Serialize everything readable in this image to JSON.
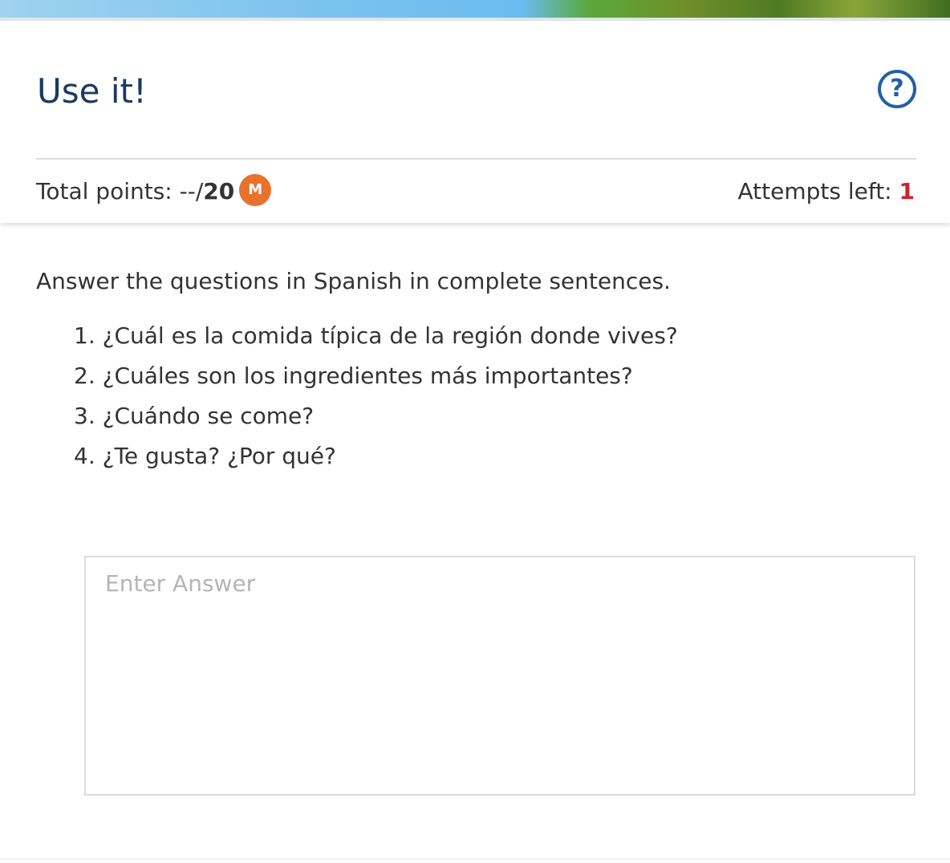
{
  "header": {
    "title": "Use it!",
    "help_icon": "question-circle-icon",
    "help_glyph": "?"
  },
  "scorebar": {
    "total_points_label": "Total points: --/",
    "total_points_max": "20",
    "badge_letter": "M",
    "badge_color": "#e8722c",
    "attempts_label": "Attempts left: ",
    "attempts_count": "1",
    "attempts_color": "#c9252b"
  },
  "content": {
    "instruction": "Answer the questions in Spanish in complete sentences.",
    "questions": [
      "1. ¿Cuál es la comida típica de la región donde vives?",
      "2. ¿Cuáles son los ingredientes más importantes?",
      "3. ¿Cuándo se come?",
      "4. ¿Te gusta? ¿Por qué?"
    ],
    "answer_placeholder": "Enter Answer",
    "answer_value": ""
  },
  "colors": {
    "title": "#1b3a63",
    "accent": "#2160a6"
  }
}
